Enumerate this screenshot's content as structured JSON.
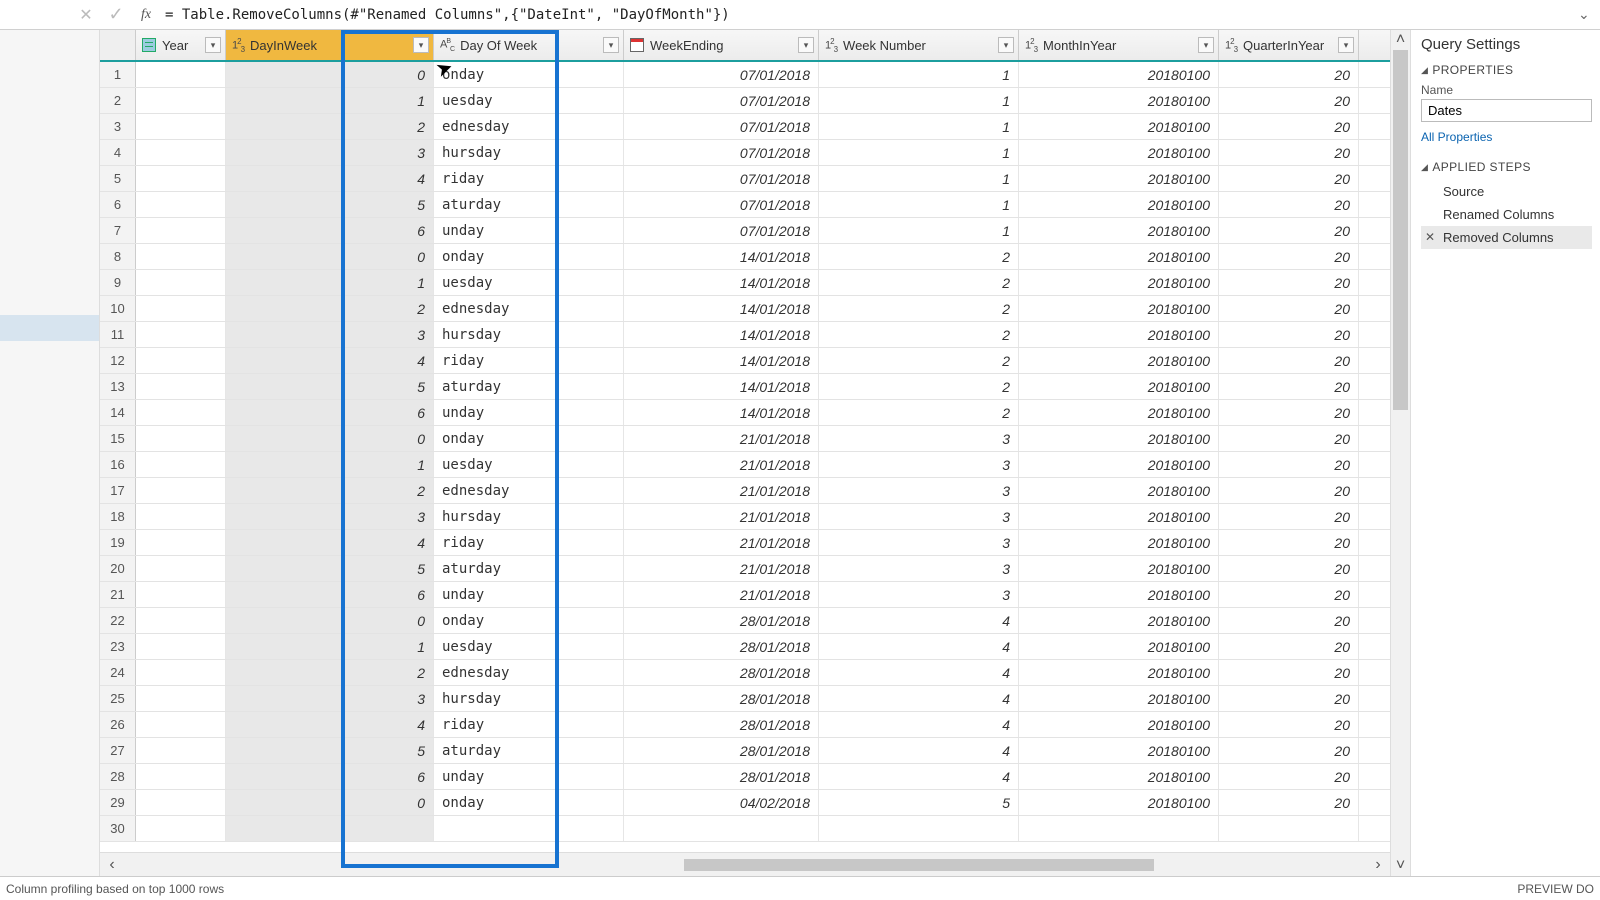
{
  "formula_bar": {
    "text": "= Table.RemoveColumns(#\"Renamed Columns\",{\"DateInt\", \"DayOfMonth\"})"
  },
  "columns": [
    {
      "key": "year",
      "label": "Year",
      "type": "table",
      "width": "w-year"
    },
    {
      "key": "dayinweek",
      "label": "DayInWeek",
      "type": "num",
      "width": "w-dayinweek",
      "selected": true
    },
    {
      "key": "dayofweek",
      "label": "Day Of Week",
      "type": "abc",
      "width": "w-dayofweek"
    },
    {
      "key": "weekending",
      "label": "WeekEnding",
      "type": "cal",
      "width": "w-weekending"
    },
    {
      "key": "weeknum",
      "label": "Week Number",
      "type": "num",
      "width": "w-weeknum"
    },
    {
      "key": "monthyear",
      "label": "MonthInYear",
      "type": "num",
      "width": "w-monthyear"
    },
    {
      "key": "qtr",
      "label": "QuarterInYear",
      "type": "num",
      "width": "w-qtr"
    }
  ],
  "rows": [
    {
      "n": 1,
      "dayinweek": "0",
      "dayofweek": "Monday",
      "weekending": "07/01/2018",
      "weeknum": "1",
      "monthyear": "20180100",
      "qtr": "20"
    },
    {
      "n": 2,
      "dayinweek": "1",
      "dayofweek": "Tuesday",
      "weekending": "07/01/2018",
      "weeknum": "1",
      "monthyear": "20180100",
      "qtr": "20"
    },
    {
      "n": 3,
      "dayinweek": "2",
      "dayofweek": "Wednesday",
      "weekending": "07/01/2018",
      "weeknum": "1",
      "monthyear": "20180100",
      "qtr": "20"
    },
    {
      "n": 4,
      "dayinweek": "3",
      "dayofweek": "Thursday",
      "weekending": "07/01/2018",
      "weeknum": "1",
      "monthyear": "20180100",
      "qtr": "20"
    },
    {
      "n": 5,
      "dayinweek": "4",
      "dayofweek": "Friday",
      "weekending": "07/01/2018",
      "weeknum": "1",
      "monthyear": "20180100",
      "qtr": "20"
    },
    {
      "n": 6,
      "dayinweek": "5",
      "dayofweek": "Saturday",
      "weekending": "07/01/2018",
      "weeknum": "1",
      "monthyear": "20180100",
      "qtr": "20"
    },
    {
      "n": 7,
      "dayinweek": "6",
      "dayofweek": "Sunday",
      "weekending": "07/01/2018",
      "weeknum": "1",
      "monthyear": "20180100",
      "qtr": "20"
    },
    {
      "n": 8,
      "dayinweek": "0",
      "dayofweek": "Monday",
      "weekending": "14/01/2018",
      "weeknum": "2",
      "monthyear": "20180100",
      "qtr": "20"
    },
    {
      "n": 9,
      "dayinweek": "1",
      "dayofweek": "Tuesday",
      "weekending": "14/01/2018",
      "weeknum": "2",
      "monthyear": "20180100",
      "qtr": "20"
    },
    {
      "n": 10,
      "dayinweek": "2",
      "dayofweek": "Wednesday",
      "weekending": "14/01/2018",
      "weeknum": "2",
      "monthyear": "20180100",
      "qtr": "20"
    },
    {
      "n": 11,
      "dayinweek": "3",
      "dayofweek": "Thursday",
      "weekending": "14/01/2018",
      "weeknum": "2",
      "monthyear": "20180100",
      "qtr": "20"
    },
    {
      "n": 12,
      "dayinweek": "4",
      "dayofweek": "Friday",
      "weekending": "14/01/2018",
      "weeknum": "2",
      "monthyear": "20180100",
      "qtr": "20"
    },
    {
      "n": 13,
      "dayinweek": "5",
      "dayofweek": "Saturday",
      "weekending": "14/01/2018",
      "weeknum": "2",
      "monthyear": "20180100",
      "qtr": "20"
    },
    {
      "n": 14,
      "dayinweek": "6",
      "dayofweek": "Sunday",
      "weekending": "14/01/2018",
      "weeknum": "2",
      "monthyear": "20180100",
      "qtr": "20"
    },
    {
      "n": 15,
      "dayinweek": "0",
      "dayofweek": "Monday",
      "weekending": "21/01/2018",
      "weeknum": "3",
      "monthyear": "20180100",
      "qtr": "20"
    },
    {
      "n": 16,
      "dayinweek": "1",
      "dayofweek": "Tuesday",
      "weekending": "21/01/2018",
      "weeknum": "3",
      "monthyear": "20180100",
      "qtr": "20"
    },
    {
      "n": 17,
      "dayinweek": "2",
      "dayofweek": "Wednesday",
      "weekending": "21/01/2018",
      "weeknum": "3",
      "monthyear": "20180100",
      "qtr": "20"
    },
    {
      "n": 18,
      "dayinweek": "3",
      "dayofweek": "Thursday",
      "weekending": "21/01/2018",
      "weeknum": "3",
      "monthyear": "20180100",
      "qtr": "20"
    },
    {
      "n": 19,
      "dayinweek": "4",
      "dayofweek": "Friday",
      "weekending": "21/01/2018",
      "weeknum": "3",
      "monthyear": "20180100",
      "qtr": "20"
    },
    {
      "n": 20,
      "dayinweek": "5",
      "dayofweek": "Saturday",
      "weekending": "21/01/2018",
      "weeknum": "3",
      "monthyear": "20180100",
      "qtr": "20"
    },
    {
      "n": 21,
      "dayinweek": "6",
      "dayofweek": "Sunday",
      "weekending": "21/01/2018",
      "weeknum": "3",
      "monthyear": "20180100",
      "qtr": "20"
    },
    {
      "n": 22,
      "dayinweek": "0",
      "dayofweek": "Monday",
      "weekending": "28/01/2018",
      "weeknum": "4",
      "monthyear": "20180100",
      "qtr": "20"
    },
    {
      "n": 23,
      "dayinweek": "1",
      "dayofweek": "Tuesday",
      "weekending": "28/01/2018",
      "weeknum": "4",
      "monthyear": "20180100",
      "qtr": "20"
    },
    {
      "n": 24,
      "dayinweek": "2",
      "dayofweek": "Wednesday",
      "weekending": "28/01/2018",
      "weeknum": "4",
      "monthyear": "20180100",
      "qtr": "20"
    },
    {
      "n": 25,
      "dayinweek": "3",
      "dayofweek": "Thursday",
      "weekending": "28/01/2018",
      "weeknum": "4",
      "monthyear": "20180100",
      "qtr": "20"
    },
    {
      "n": 26,
      "dayinweek": "4",
      "dayofweek": "Friday",
      "weekending": "28/01/2018",
      "weeknum": "4",
      "monthyear": "20180100",
      "qtr": "20"
    },
    {
      "n": 27,
      "dayinweek": "5",
      "dayofweek": "Saturday",
      "weekending": "28/01/2018",
      "weeknum": "4",
      "monthyear": "20180100",
      "qtr": "20"
    },
    {
      "n": 28,
      "dayinweek": "6",
      "dayofweek": "Sunday",
      "weekending": "28/01/2018",
      "weeknum": "4",
      "monthyear": "20180100",
      "qtr": "20"
    },
    {
      "n": 29,
      "dayinweek": "0",
      "dayofweek": "Monday",
      "weekending": "04/02/2018",
      "weeknum": "5",
      "monthyear": "20180100",
      "qtr": "20"
    },
    {
      "n": 30,
      "dayinweek": "",
      "dayofweek": "",
      "weekending": "",
      "weeknum": "",
      "monthyear": "",
      "qtr": ""
    }
  ],
  "right_panel": {
    "title": "Query Settings",
    "properties_label": "PROPERTIES",
    "name_label": "Name",
    "name_value": "Dates",
    "all_props": "All Properties",
    "steps_label": "APPLIED STEPS",
    "steps": [
      {
        "label": "Source"
      },
      {
        "label": "Renamed Columns"
      },
      {
        "label": "Removed Columns",
        "selected": true,
        "deletable": true
      }
    ]
  },
  "status": {
    "left": "Column profiling based on top 1000 rows",
    "right": "PREVIEW DO"
  }
}
